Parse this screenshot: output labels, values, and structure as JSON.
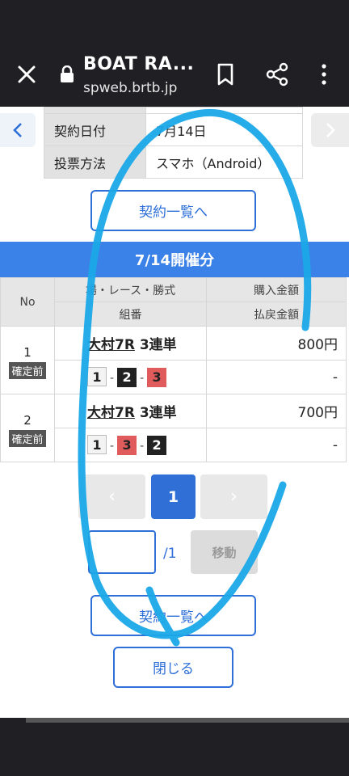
{
  "browser": {
    "title": "BOAT RA...",
    "url": "spweb.brtb.jp"
  },
  "info": {
    "date_label": "契約日付",
    "date_value": "7月14日",
    "method_label": "投票方法",
    "method_value": "スマホ（Android）"
  },
  "buttons": {
    "contract_list": "契約一覧へ",
    "contract_list_bottom": "契約一覧へ",
    "close": "閉じる",
    "move": "移動"
  },
  "section": {
    "title": "7/14開催分"
  },
  "table": {
    "header_no": "No",
    "header_race": "場・レース・勝式",
    "header_combo": "組番",
    "header_purchase": "購入金額",
    "header_payout": "払戻金額",
    "rows": [
      {
        "no": "1",
        "status": "確定前",
        "venue_race": "大村7R",
        "bet_type": "3連単",
        "combo": [
          "1",
          "2",
          "3"
        ],
        "purchase": "800円",
        "payout": "-"
      },
      {
        "no": "2",
        "status": "確定前",
        "venue_race": "大村7R",
        "bet_type": "3連単",
        "combo": [
          "1",
          "3",
          "2"
        ],
        "purchase": "700円",
        "payout": "-"
      }
    ]
  },
  "pagination": {
    "current": "1",
    "total": "/1",
    "prev": "‹",
    "next": "›"
  },
  "colors": {
    "accent": "#2e6fd8",
    "section": "#3b82e8",
    "overlay_stroke": "#1aa8e8"
  }
}
